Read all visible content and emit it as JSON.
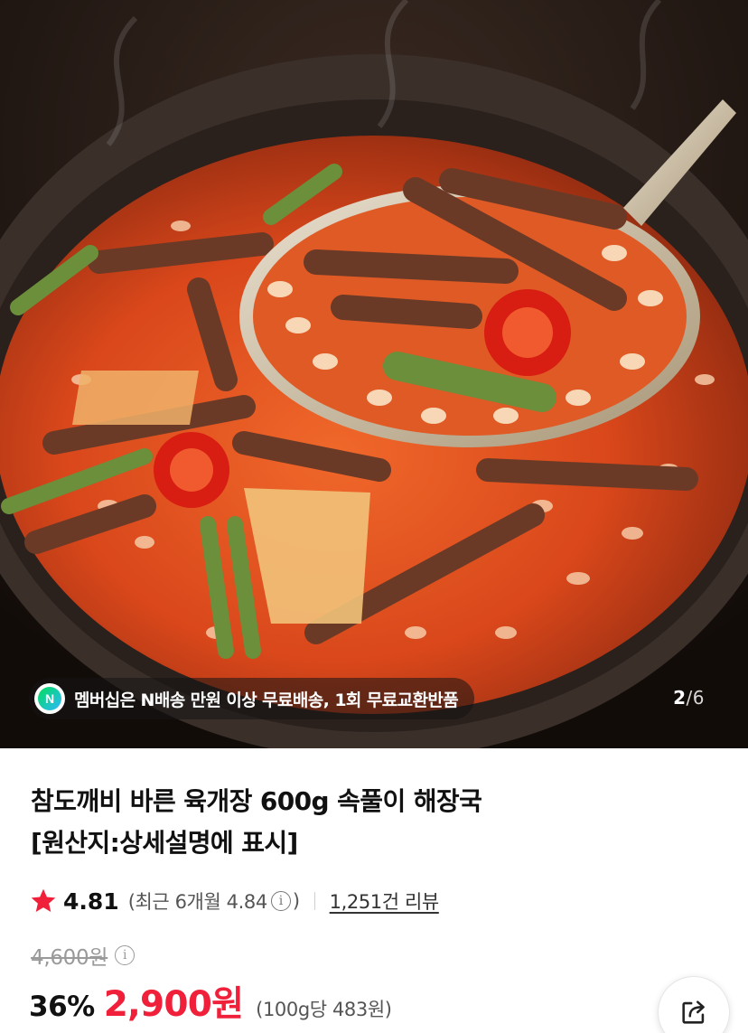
{
  "product_image": {
    "banner": {
      "badge_letter": "N",
      "text": "멤버십은 N배송 만원 이상 무료배송, 1회 무료교환반품"
    },
    "pager": {
      "current": "2",
      "separator": "/",
      "total": "6"
    }
  },
  "product": {
    "title_line1": "참도깨비 바른 육개장 600g 속풀이 해장국",
    "title_line2": "[원산지:상세설명에 표시]"
  },
  "rating": {
    "score": "4.81",
    "recent_prefix": "(최근 6개월 4.84",
    "recent_suffix": ")",
    "info_icon": "i",
    "reviews": "1,251건 리뷰"
  },
  "price": {
    "original": "4,600원",
    "info_icon": "i",
    "discount": "36%",
    "sale": "2,900원",
    "unit": "(100g당 483원)"
  },
  "colors": {
    "accent_red": "#f0203a",
    "star": "#f0203a",
    "text_primary": "#111111",
    "text_secondary": "#555555"
  },
  "icons": {
    "star": "star-icon",
    "info": "info-icon",
    "share": "share-icon",
    "naver_badge": "naver-membership-icon"
  }
}
